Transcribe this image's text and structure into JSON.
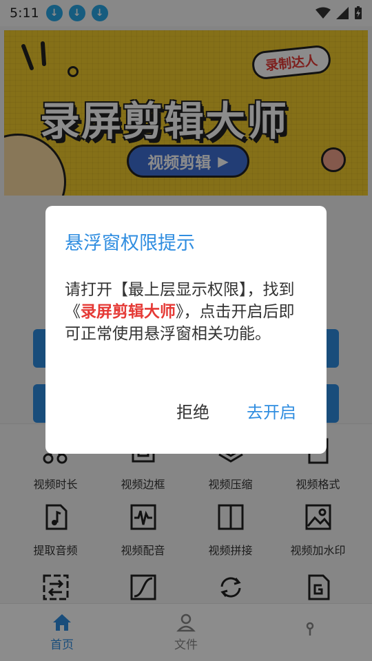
{
  "status_bar": {
    "time": "5:11",
    "notification_icons": [
      "download-icon",
      "download-icon",
      "download-icon"
    ],
    "right_icons": [
      "wifi-icon",
      "signal-icon",
      "battery-charging-icon"
    ]
  },
  "banner": {
    "tag": "录制达人",
    "title": "录屏剪辑大师",
    "pill_label": "视频剪辑"
  },
  "features": [
    {
      "label": "视频时长",
      "icon": "scissors-icon"
    },
    {
      "label": "视频边框",
      "icon": "frame-icon"
    },
    {
      "label": "视频压缩",
      "icon": "layers-icon"
    },
    {
      "label": "视频格式",
      "icon": "format-icon"
    },
    {
      "label": "提取音频",
      "icon": "music-file-icon"
    },
    {
      "label": "视频配音",
      "icon": "waveform-icon"
    },
    {
      "label": "视频拼接",
      "icon": "split-panel-icon"
    },
    {
      "label": "视频加水印",
      "icon": "image-icon"
    },
    {
      "label": "",
      "icon": "transfer-icon"
    },
    {
      "label": "",
      "icon": "curve-icon"
    },
    {
      "label": "",
      "icon": "rotate-icon"
    },
    {
      "label": "",
      "icon": "gif-file-icon"
    }
  ],
  "tabs": [
    {
      "label": "首页",
      "icon": "home-icon",
      "active": true
    },
    {
      "label": "文件",
      "icon": "user-icon",
      "active": false
    },
    {
      "label": "",
      "icon": "profile-icon",
      "active": false
    }
  ],
  "dialog": {
    "title": "悬浮窗权限提示",
    "body_prefix": "请打开【最上层显示权限】，找到《",
    "app_name": "录屏剪辑大师",
    "body_suffix": "》，点击开启后即可正常使用悬浮窗相关功能。",
    "reject_label": "拒绝",
    "open_label": "去开启"
  },
  "colors": {
    "accent": "#2f8de0",
    "highlight": "#e53935",
    "banner_bg": "#f3cc2c"
  }
}
